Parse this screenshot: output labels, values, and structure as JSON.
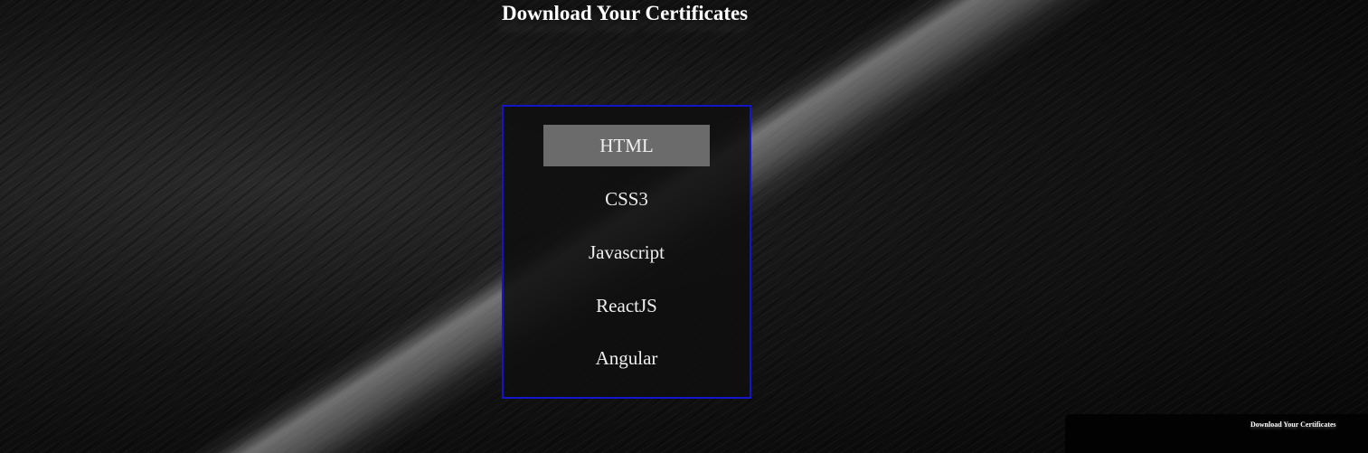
{
  "page": {
    "title": "Download Your Certificates"
  },
  "certificates": {
    "items": [
      {
        "label": "HTML",
        "active": true
      },
      {
        "label": "CSS3",
        "active": false
      },
      {
        "label": "Javascript",
        "active": false
      },
      {
        "label": "ReactJS",
        "active": false
      },
      {
        "label": "Angular",
        "active": false
      }
    ]
  },
  "preview": {
    "title": "Download Your Certificates"
  },
  "colors": {
    "panel_border": "#1414c8",
    "active_item_bg": "#6b6b6b",
    "text": "#eeeeee"
  }
}
